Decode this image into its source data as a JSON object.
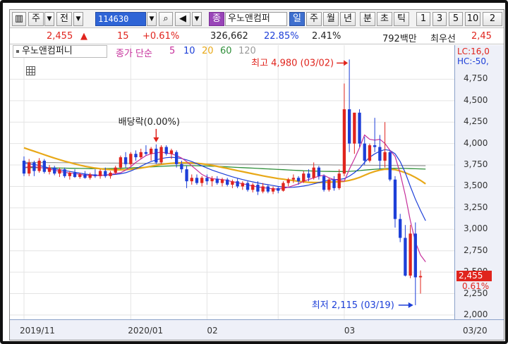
{
  "toolbar": {
    "menu_icon": "list-icon",
    "type_label": "주",
    "prev_label": "전",
    "code": "114630",
    "stock_tab": "종",
    "stock_name": "우노앤컴퍼",
    "periods": [
      "일",
      "주",
      "월",
      "년",
      "분",
      "초",
      "틱"
    ],
    "active_period": "일",
    "minute_values": [
      "1",
      "3",
      "5",
      "10",
      "2"
    ]
  },
  "quote": {
    "price": "2,455",
    "arrow": "▲",
    "change": "15",
    "change_pct": "+0.61%",
    "volume": "326,662",
    "turnover_pct": "22.85%",
    "pct2": "2.41%",
    "amount": "792백만",
    "best_ask_label": "최우선",
    "best_ask_value": "2,45"
  },
  "legend": {
    "name": "우노앤컴퍼니",
    "ma_label": "종가 단순",
    "ma_periods": [
      "5",
      "10",
      "20",
      "60",
      "120"
    ],
    "ma_colors": [
      "#c62f9b",
      "#1d3fd8",
      "#e8a817",
      "#2f8f3a",
      "#9a9a9a"
    ]
  },
  "chart_data": {
    "type": "candlestick",
    "y_ticks": [
      "4,750",
      "4,500",
      "4,250",
      "4,000",
      "3,750",
      "3,500",
      "3,250",
      "3,000",
      "2,750",
      "2,500",
      "2,250",
      "2,000"
    ],
    "ylim": [
      1950,
      5000
    ],
    "x_ticks": [
      "2019/11",
      "2020/01",
      "02",
      "03",
      "03/20"
    ],
    "colors": {
      "up": "#e0241d",
      "down": "#1d3fd8"
    },
    "current_price_tag": "2,455",
    "current_pct_tag": "0.61%",
    "lc_label": "LC:16,0",
    "hc_label": "HC:-50,",
    "annotations": {
      "high": "최고 4,980 (03/02)",
      "low": "최저 2,115 (03/19)",
      "dividend": "배당락(0.00%)"
    },
    "candles": [
      {
        "o": 3800,
        "h": 3850,
        "l": 3620,
        "c": 3650
      },
      {
        "o": 3650,
        "h": 3820,
        "l": 3620,
        "c": 3780
      },
      {
        "o": 3780,
        "h": 3800,
        "l": 3620,
        "c": 3680
      },
      {
        "o": 3680,
        "h": 3830,
        "l": 3660,
        "c": 3800
      },
      {
        "o": 3800,
        "h": 3820,
        "l": 3650,
        "c": 3670
      },
      {
        "o": 3670,
        "h": 3750,
        "l": 3640,
        "c": 3720
      },
      {
        "o": 3720,
        "h": 3740,
        "l": 3630,
        "c": 3650
      },
      {
        "o": 3650,
        "h": 3720,
        "l": 3610,
        "c": 3700
      },
      {
        "o": 3700,
        "h": 3720,
        "l": 3600,
        "c": 3620
      },
      {
        "o": 3620,
        "h": 3680,
        "l": 3580,
        "c": 3660
      },
      {
        "o": 3660,
        "h": 3700,
        "l": 3600,
        "c": 3610
      },
      {
        "o": 3610,
        "h": 3660,
        "l": 3590,
        "c": 3640
      },
      {
        "o": 3640,
        "h": 3680,
        "l": 3590,
        "c": 3600
      },
      {
        "o": 3600,
        "h": 3660,
        "l": 3580,
        "c": 3640
      },
      {
        "o": 3640,
        "h": 3700,
        "l": 3600,
        "c": 3620
      },
      {
        "o": 3620,
        "h": 3700,
        "l": 3590,
        "c": 3680
      },
      {
        "o": 3680,
        "h": 3720,
        "l": 3600,
        "c": 3620
      },
      {
        "o": 3620,
        "h": 3680,
        "l": 3590,
        "c": 3660
      },
      {
        "o": 3660,
        "h": 3740,
        "l": 3640,
        "c": 3720
      },
      {
        "o": 3720,
        "h": 3860,
        "l": 3700,
        "c": 3840
      },
      {
        "o": 3840,
        "h": 3900,
        "l": 3720,
        "c": 3760
      },
      {
        "o": 3760,
        "h": 3900,
        "l": 3740,
        "c": 3880
      },
      {
        "o": 3880,
        "h": 3920,
        "l": 3800,
        "c": 3840
      },
      {
        "o": 3840,
        "h": 3940,
        "l": 3820,
        "c": 3900
      },
      {
        "o": 3900,
        "h": 3980,
        "l": 3860,
        "c": 3880
      },
      {
        "o": 3880,
        "h": 3960,
        "l": 3800,
        "c": 3940
      },
      {
        "o": 3940,
        "h": 3990,
        "l": 3760,
        "c": 3780
      },
      {
        "o": 3780,
        "h": 3980,
        "l": 3760,
        "c": 3960
      },
      {
        "o": 3960,
        "h": 3980,
        "l": 3860,
        "c": 3880
      },
      {
        "o": 3880,
        "h": 3940,
        "l": 3820,
        "c": 3920
      },
      {
        "o": 3900,
        "h": 3920,
        "l": 3720,
        "c": 3760
      },
      {
        "o": 3760,
        "h": 3800,
        "l": 3660,
        "c": 3700
      },
      {
        "o": 3700,
        "h": 3740,
        "l": 3480,
        "c": 3560
      },
      {
        "o": 3560,
        "h": 3640,
        "l": 3520,
        "c": 3600
      },
      {
        "o": 3600,
        "h": 3640,
        "l": 3520,
        "c": 3540
      },
      {
        "o": 3540,
        "h": 3620,
        "l": 3500,
        "c": 3600
      },
      {
        "o": 3600,
        "h": 3640,
        "l": 3520,
        "c": 3560
      },
      {
        "o": 3560,
        "h": 3620,
        "l": 3500,
        "c": 3590
      },
      {
        "o": 3590,
        "h": 3620,
        "l": 3520,
        "c": 3540
      },
      {
        "o": 3540,
        "h": 3600,
        "l": 3500,
        "c": 3580
      },
      {
        "o": 3580,
        "h": 3600,
        "l": 3500,
        "c": 3520
      },
      {
        "o": 3520,
        "h": 3580,
        "l": 3480,
        "c": 3560
      },
      {
        "o": 3560,
        "h": 3590,
        "l": 3480,
        "c": 3500
      },
      {
        "o": 3500,
        "h": 3560,
        "l": 3460,
        "c": 3540
      },
      {
        "o": 3540,
        "h": 3560,
        "l": 3440,
        "c": 3460
      },
      {
        "o": 3460,
        "h": 3540,
        "l": 3430,
        "c": 3520
      },
      {
        "o": 3520,
        "h": 3560,
        "l": 3400,
        "c": 3440
      },
      {
        "o": 3440,
        "h": 3540,
        "l": 3420,
        "c": 3500
      },
      {
        "o": 3500,
        "h": 3520,
        "l": 3420,
        "c": 3440
      },
      {
        "o": 3440,
        "h": 3500,
        "l": 3410,
        "c": 3480
      },
      {
        "o": 3480,
        "h": 3500,
        "l": 3420,
        "c": 3450
      },
      {
        "o": 3450,
        "h": 3560,
        "l": 3440,
        "c": 3540
      },
      {
        "o": 3540,
        "h": 3600,
        "l": 3500,
        "c": 3580
      },
      {
        "o": 3580,
        "h": 3640,
        "l": 3540,
        "c": 3600
      },
      {
        "o": 3600,
        "h": 3620,
        "l": 3520,
        "c": 3560
      },
      {
        "o": 3560,
        "h": 3680,
        "l": 3540,
        "c": 3650
      },
      {
        "o": 3650,
        "h": 3700,
        "l": 3560,
        "c": 3600
      },
      {
        "o": 3600,
        "h": 3780,
        "l": 3580,
        "c": 3720
      },
      {
        "o": 3720,
        "h": 3740,
        "l": 3580,
        "c": 3620
      },
      {
        "o": 3620,
        "h": 3640,
        "l": 3440,
        "c": 3460
      },
      {
        "o": 3460,
        "h": 3600,
        "l": 3440,
        "c": 3580
      },
      {
        "o": 3580,
        "h": 3620,
        "l": 3450,
        "c": 3480
      },
      {
        "o": 3480,
        "h": 3700,
        "l": 3460,
        "c": 3650
      },
      {
        "o": 3650,
        "h": 4700,
        "l": 3620,
        "c": 4400
      },
      {
        "o": 4400,
        "h": 4980,
        "l": 3900,
        "c": 4000
      },
      {
        "o": 4000,
        "h": 4360,
        "l": 3880,
        "c": 4360
      },
      {
        "o": 4360,
        "h": 4400,
        "l": 3960,
        "c": 4000
      },
      {
        "o": 4000,
        "h": 4080,
        "l": 3750,
        "c": 3800
      },
      {
        "o": 3800,
        "h": 4000,
        "l": 3780,
        "c": 3980
      },
      {
        "o": 3980,
        "h": 4300,
        "l": 3900,
        "c": 3960
      },
      {
        "o": 3960,
        "h": 4100,
        "l": 3700,
        "c": 3800
      },
      {
        "o": 3800,
        "h": 4250,
        "l": 3720,
        "c": 3900
      },
      {
        "o": 3900,
        "h": 3920,
        "l": 3560,
        "c": 3580
      },
      {
        "o": 3580,
        "h": 3620,
        "l": 3020,
        "c": 3120
      },
      {
        "o": 3120,
        "h": 3180,
        "l": 2850,
        "c": 2900
      },
      {
        "o": 2900,
        "h": 3050,
        "l": 2450,
        "c": 2460
      },
      {
        "o": 2460,
        "h": 3050,
        "l": 2430,
        "c": 2950
      },
      {
        "o": 2950,
        "h": 3080,
        "l": 2115,
        "c": 2440
      },
      {
        "o": 2440,
        "h": 2520,
        "l": 2250,
        "c": 2455
      }
    ],
    "ma5": [
      3720,
      3730,
      3730,
      3720,
      3715,
      3700,
      3690,
      3675,
      3665,
      3655,
      3650,
      3640,
      3630,
      3628,
      3627,
      3628,
      3632,
      3640,
      3650,
      3660,
      3690,
      3730,
      3780,
      3820,
      3860,
      3880,
      3890,
      3900,
      3890,
      3880,
      3860,
      3830,
      3790,
      3740,
      3690,
      3640,
      3610,
      3590,
      3585,
      3580,
      3570,
      3555,
      3545,
      3530,
      3520,
      3505,
      3495,
      3485,
      3480,
      3470,
      3470,
      3478,
      3490,
      3510,
      3530,
      3560,
      3580,
      3600,
      3620,
      3630,
      3600,
      3580,
      3570,
      3560,
      3700,
      3820,
      3950,
      4100,
      4050,
      4040,
      4050,
      4000,
      3920,
      3850,
      3650,
      3400,
      3100,
      2850,
      2700,
      2620
    ],
    "ma10": [
      3770,
      3765,
      3755,
      3745,
      3730,
      3715,
      3705,
      3695,
      3685,
      3675,
      3665,
      3655,
      3645,
      3638,
      3633,
      3630,
      3632,
      3635,
      3640,
      3648,
      3660,
      3680,
      3705,
      3735,
      3765,
      3790,
      3810,
      3825,
      3835,
      3840,
      3835,
      3825,
      3810,
      3790,
      3765,
      3740,
      3715,
      3690,
      3670,
      3650,
      3630,
      3612,
      3596,
      3580,
      3566,
      3553,
      3541,
      3530,
      3520,
      3510,
      3500,
      3492,
      3488,
      3490,
      3496,
      3505,
      3515,
      3530,
      3545,
      3560,
      3575,
      3580,
      3582,
      3590,
      3620,
      3660,
      3710,
      3780,
      3840,
      3880,
      3910,
      3930,
      3920,
      3880,
      3790,
      3660,
      3500,
      3350,
      3220,
      3100
    ],
    "ma20": [
      3950,
      3930,
      3910,
      3890,
      3870,
      3850,
      3830,
      3812,
      3794,
      3778,
      3762,
      3748,
      3735,
      3724,
      3714,
      3706,
      3700,
      3696,
      3694,
      3694,
      3696,
      3700,
      3706,
      3714,
      3724,
      3735,
      3746,
      3756,
      3764,
      3770,
      3774,
      3776,
      3776,
      3774,
      3770,
      3764,
      3756,
      3746,
      3734,
      3722,
      3710,
      3697,
      3684,
      3672,
      3660,
      3648,
      3636,
      3624,
      3612,
      3602,
      3592,
      3584,
      3576,
      3568,
      3560,
      3553,
      3548,
      3546,
      3546,
      3548,
      3550,
      3552,
      3555,
      3560,
      3570,
      3585,
      3605,
      3630,
      3655,
      3675,
      3690,
      3700,
      3700,
      3695,
      3680,
      3660,
      3635,
      3605,
      3570,
      3530
    ],
    "ma60": [
      3720,
      3720,
      3719,
      3718,
      3717,
      3716,
      3715,
      3714,
      3713,
      3712,
      3711,
      3710,
      3709,
      3708,
      3708,
      3708,
      3708,
      3709,
      3710,
      3712,
      3714,
      3716,
      3719,
      3722,
      3725,
      3728,
      3731,
      3734,
      3737,
      3739,
      3741,
      3742,
      3742,
      3742,
      3741,
      3740,
      3738,
      3736,
      3734,
      3731,
      3728,
      3725,
      3722,
      3719,
      3716,
      3713,
      3710,
      3707,
      3704,
      3701,
      3698,
      3695,
      3692,
      3689,
      3686,
      3683,
      3681,
      3679,
      3677,
      3676,
      3675,
      3674,
      3674,
      3674,
      3676,
      3680,
      3685,
      3690,
      3695,
      3700,
      3704,
      3708,
      3710,
      3711,
      3711,
      3710,
      3708,
      3706,
      3704,
      3702
    ],
    "ma120": [
      3780,
      3780,
      3780,
      3779,
      3779,
      3778,
      3778,
      3777,
      3777,
      3776,
      3776,
      3775,
      3775,
      3774,
      3774,
      3773,
      3773,
      3772,
      3772,
      3771,
      3771,
      3770,
      3770,
      3769,
      3769,
      3768,
      3768,
      3767,
      3767,
      3766,
      3766,
      3765,
      3765,
      3764,
      3764,
      3763,
      3763,
      3762,
      3762,
      3761,
      3761,
      3760,
      3760,
      3759,
      3759,
      3758,
      3758,
      3757,
      3757,
      3756,
      3756,
      3755,
      3755,
      3754,
      3754,
      3753,
      3753,
      3752,
      3752,
      3751,
      3751,
      3750,
      3750,
      3749,
      3749,
      3748,
      3748,
      3747,
      3747,
      3746,
      3746,
      3745,
      3745,
      3744,
      3744,
      3743,
      3743,
      3742,
      3742,
      3741
    ]
  }
}
